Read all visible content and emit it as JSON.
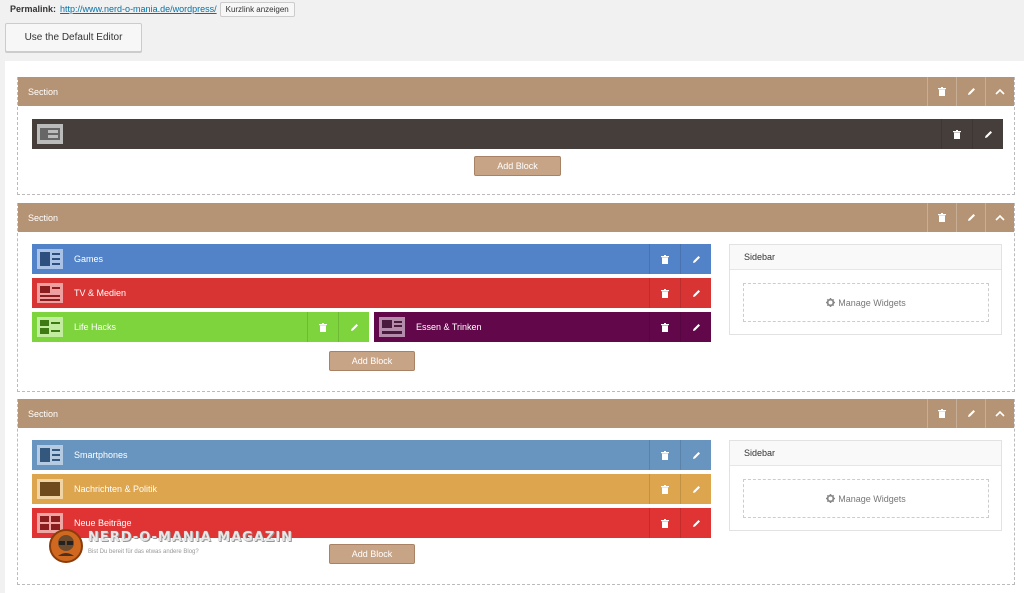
{
  "permalink": {
    "label": "Permalink:",
    "url": "http://www.nerd-o-mania.de/wordpress/",
    "shortlink_button": "Kurzlink anzeigen"
  },
  "default_editor_button": "Use the Default Editor",
  "add_block_label": "Add Block",
  "manage_widgets_label": "Manage Widgets",
  "sections": [
    {
      "title": "Section",
      "blocks": [
        {
          "name": "",
          "color": "#463e3a"
        }
      ]
    },
    {
      "title": "Section",
      "sidebar_title": "Sidebar",
      "blocks": [
        {
          "name": "Games",
          "color": "#5283c8"
        },
        {
          "name": "TV & Medien",
          "color": "#d93434"
        },
        {
          "name": "Life Hacks",
          "color": "#7ed43c"
        },
        {
          "name": "Essen & Trinken",
          "color": "#62084a"
        }
      ]
    },
    {
      "title": "Section",
      "sidebar_title": "Sidebar",
      "blocks": [
        {
          "name": "Smartphones",
          "color": "#6895c0"
        },
        {
          "name": "Nachrichten & Politik",
          "color": "#dca54e"
        },
        {
          "name": "Neue Beiträge",
          "color": "#e03333"
        }
      ]
    }
  ],
  "watermark": {
    "title": "NERD-O-MANIA MAGAZIN",
    "tagline": "Bist Du bereit für das etwas andere Blog?"
  },
  "icons": [
    "trash-icon",
    "pencil-icon",
    "chevron-up-icon",
    "gear-icon"
  ]
}
